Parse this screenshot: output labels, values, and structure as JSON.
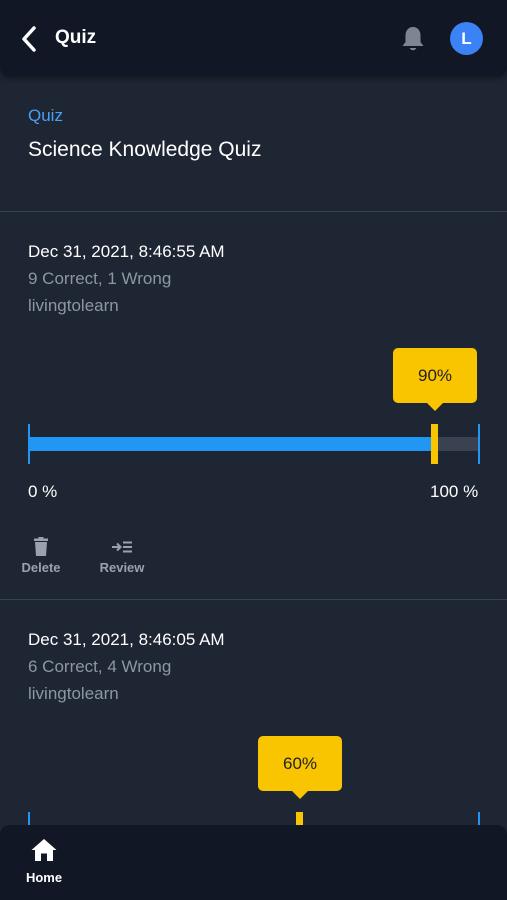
{
  "topbar": {
    "title": "Quiz",
    "avatar_initial": "L"
  },
  "header": {
    "breadcrumb": "Quiz",
    "quiz_title": "Science Knowledge Quiz"
  },
  "attempts": [
    {
      "date": "Dec 31, 2021, 8:46:55 AM",
      "score_text": "9 Correct, 1 Wrong",
      "user": "livingtolearn",
      "percent_label": "90%",
      "percent": 90,
      "axis_min": "0 %",
      "axis_max": "100 %",
      "actions": {
        "delete": "Delete",
        "review": "Review"
      }
    },
    {
      "date": "Dec 31, 2021, 8:46:05 AM",
      "score_text": "6 Correct, 4 Wrong",
      "user": "livingtolearn",
      "percent_label": "60%",
      "percent": 60
    }
  ],
  "bottom_nav": {
    "home_label": "Home"
  },
  "colors": {
    "accent": "#2196f3",
    "marker": "#f9c500",
    "background": "#1e2533",
    "bar_background": "#111725"
  },
  "icons": [
    "chevron-left-icon",
    "bell-icon",
    "trash-icon",
    "review-icon",
    "home-icon"
  ]
}
